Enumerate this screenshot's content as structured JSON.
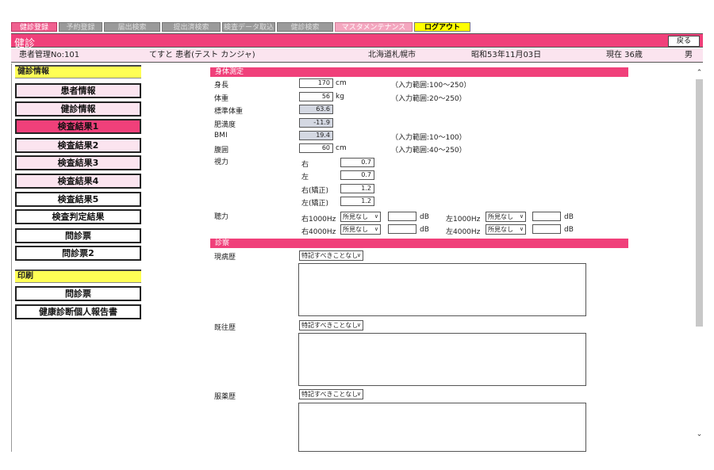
{
  "nav": {
    "tabs": [
      "健診登録",
      "予約登録",
      "届出検索",
      "提出済検索",
      "検査データ取込",
      "健診検索",
      "マスタメンテナンス",
      "ログアウト"
    ]
  },
  "header": {
    "title": "健診",
    "back_label": "戻る"
  },
  "patient": {
    "id": "患者管理No:101",
    "name": "てすと 患者(テスト カンジャ)",
    "address": "北海道札幌市",
    "birthdate": "昭和53年11月03日",
    "age": "現在 36歳",
    "sex": "男"
  },
  "sidebar": {
    "section1_title": "健診情報",
    "items": [
      "患者情報",
      "健診情報",
      "検査結果1",
      "検査結果2",
      "検査結果3",
      "検査結果4",
      "検査結果5",
      "検査判定結果",
      "問診票",
      "問診票2"
    ],
    "section2_title": "印刷",
    "print_items": [
      "問診票",
      "健康診断個人報告書"
    ]
  },
  "body_measure": {
    "title": "身体測定",
    "height": {
      "label": "身長",
      "value": "170",
      "unit": "cm",
      "note": "（入力範囲:100～250）"
    },
    "weight": {
      "label": "体重",
      "value": "56",
      "unit": "kg",
      "note": "（入力範囲:20～250）"
    },
    "std_weight": {
      "label": "標準体重",
      "value": "63.6"
    },
    "obesity": {
      "label": "肥満度",
      "value": "-11.9"
    },
    "bmi": {
      "label": "BMI",
      "value": "19.4",
      "note": "（入力範囲:10～100）"
    },
    "waist": {
      "label": "腹囲",
      "value": "60",
      "unit": "cm",
      "note": "（入力範囲:40～250）"
    },
    "vision": {
      "label": "視力",
      "right": {
        "label": "右",
        "value": "0.7"
      },
      "left": {
        "label": "左",
        "value": "0.7"
      },
      "right_corr": {
        "label": "右(矯正)",
        "value": "1.2"
      },
      "left_corr": {
        "label": "左(矯正)",
        "value": "1.2"
      }
    },
    "hearing": {
      "label": "聴力",
      "r1000_label": "右1000Hz",
      "r1000_value": "所見なし",
      "l1000_label": "左1000Hz",
      "l1000_value": "所見なし",
      "r4000_label": "右4000Hz",
      "r4000_value": "所見なし",
      "l4000_label": "左4000Hz",
      "l4000_value": "所見なし",
      "unit": "dB"
    }
  },
  "exam": {
    "title": "診察",
    "present_illness": {
      "label": "現病歴",
      "value": "特記すべきことなし"
    },
    "past_history": {
      "label": "既往歴",
      "value": "特記すべきことなし"
    },
    "medication": {
      "label": "服薬歴",
      "value": "特記すべきことなし"
    }
  }
}
